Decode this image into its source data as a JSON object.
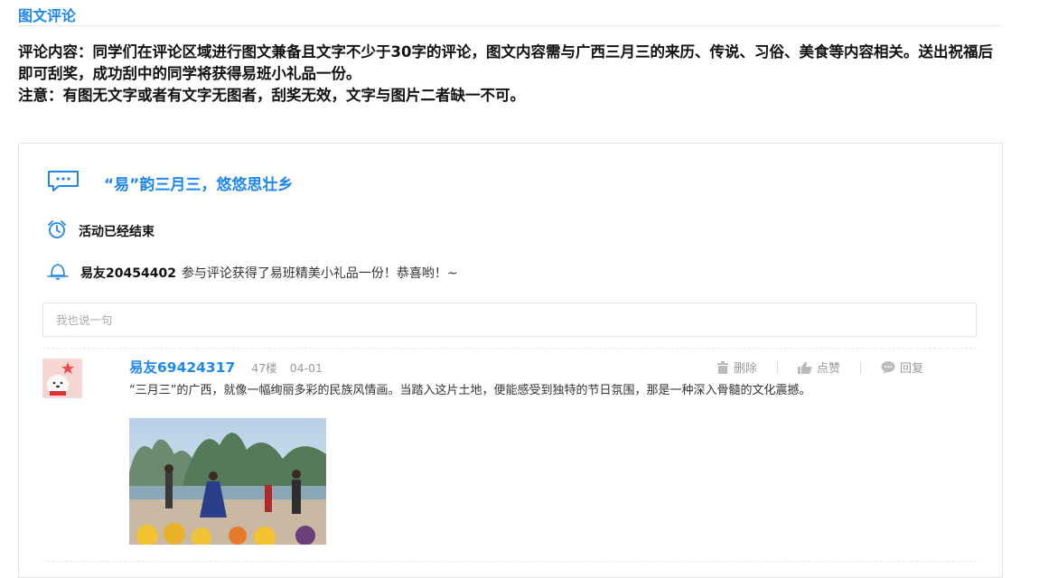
{
  "section": {
    "title": "图文评论"
  },
  "rules": {
    "content": "评论内容：同学们在评论区域进行图文兼备且文字不少于30字的评论，图文内容需与广西三月三的来历、传说、习俗、美食等内容相关。送出祝福后即可刮奖，成功刮中的同学将获得易班小礼品一份。",
    "note": "注意：有图无文字或者有文字无图者，刮奖无效，文字与图片二者缺一不可。"
  },
  "activity": {
    "title": "“易”韵三月三，悠悠思壮乡",
    "status": "活动已经结束",
    "notice_user": "易友20454402",
    "notice_text": "参与评论获得了易班精美小礼品一份！恭喜哟！~"
  },
  "comment_box": {
    "placeholder": "我也说一句"
  },
  "comment": {
    "user": "易友69424317",
    "floor": "47楼",
    "date": "04-01",
    "text": "“三月三”的广西，就像一幅绚丽多彩的民族风情画。当踏入这片土地，便能感受到独特的节日氛围，那是一种深入骨髓的文化震撼。",
    "actions": {
      "delete": "删除",
      "like": "点赞",
      "reply": "回复"
    }
  },
  "colors": {
    "accent": "#1e87f0",
    "muted": "#999999"
  },
  "icons": [
    "chat-icon",
    "alarm-clock-icon",
    "bell-icon",
    "trash-icon",
    "thumbs-up-icon",
    "reply-bubble-icon"
  ]
}
